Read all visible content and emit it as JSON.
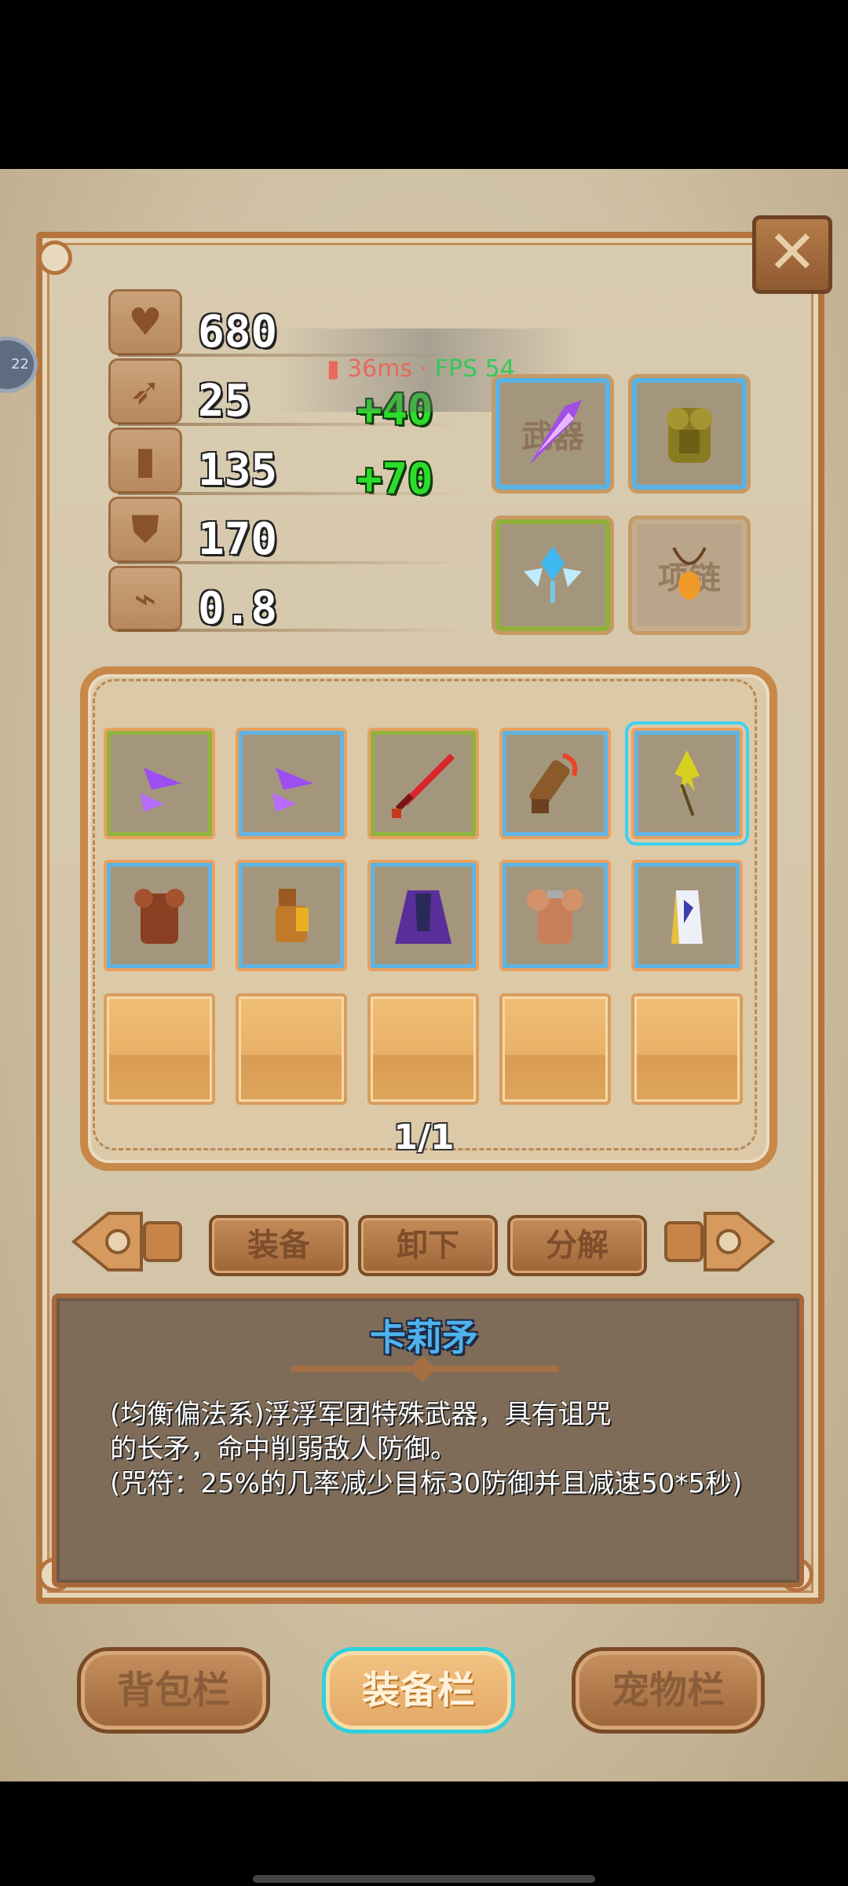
{
  "stats": [
    {
      "name": "hp",
      "icon": "heart-icon",
      "value": "680",
      "bonus": ""
    },
    {
      "name": "attack",
      "icon": "bow-icon",
      "value": "25",
      "bonus": "+40"
    },
    {
      "name": "magic",
      "icon": "crystal-icon",
      "value": "135",
      "bonus": "+70"
    },
    {
      "name": "defense",
      "icon": "shield-icon",
      "value": "170",
      "bonus": ""
    },
    {
      "name": "speed",
      "icon": "boot-icon",
      "value": "0.8",
      "bonus": ""
    }
  ],
  "overlay": {
    "latency": "36ms",
    "fps": "FPS 54",
    "side_badge": "22"
  },
  "equipped": {
    "weapon_label": "武器",
    "armor_label": "",
    "ornament_label": "",
    "necklace_label": "项链"
  },
  "inventory": {
    "page": "1/1"
  },
  "actions": {
    "equip": "装备",
    "unequip": "卸下",
    "decompose": "分解"
  },
  "item": {
    "name": "卡莉矛",
    "desc_lines": [
      "(均衡偏法系)浮浮军团特殊武器，具有诅咒",
      "的长矛，命中削弱敌人防御。",
      "(咒符：25%的几率减少目标30防御并且减速50*5秒)"
    ]
  },
  "tabs": {
    "backpack": "背包栏",
    "equipment": "装备栏",
    "pets": "宠物栏"
  }
}
